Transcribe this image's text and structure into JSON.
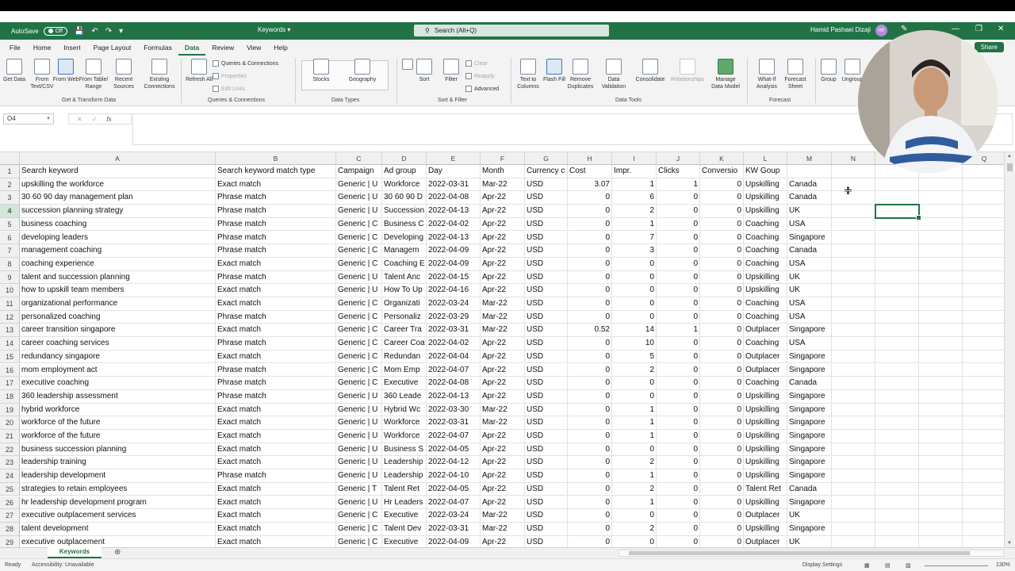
{
  "titlebar": {
    "autosave_label": "AutoSave",
    "autosave_state": "Off",
    "doc_title": "Keywords",
    "search_placeholder": "Search (Alt+Q)",
    "user_name": "Hamid Pashaei Dizaji",
    "user_initials": "HP"
  },
  "menu": {
    "tabs": [
      "File",
      "Home",
      "Insert",
      "Page Layout",
      "Formulas",
      "Data",
      "Review",
      "View",
      "Help"
    ],
    "active": "Data",
    "share_label": "Share"
  },
  "ribbon": {
    "get_data": "Get Data",
    "from_text": "From Text/CSV",
    "from_web": "From Web",
    "from_table": "From Table/ Range",
    "recent_sources": "Recent Sources",
    "existing_connections": "Existing Connections",
    "group_get_transform": "Get & Transform Data",
    "refresh_all": "Refresh All",
    "queries_connections": "Queries & Connections",
    "properties": "Properties",
    "edit_links": "Edit Links",
    "group_queries": "Queries & Connections",
    "stocks": "Stocks",
    "geography": "Geography",
    "group_data_types": "Data Types",
    "sort": "Sort",
    "filter": "Filter",
    "clear": "Clear",
    "reapply": "Reapply",
    "advanced": "Advanced",
    "group_sort_filter": "Sort & Filter",
    "text_to_columns": "Text to Columns",
    "flash_fill": "Flash Fill",
    "remove_duplicates": "Remove Duplicates",
    "data_validation": "Data Validation",
    "consolidate": "Consolidate",
    "relationships": "Relationships",
    "manage_data_model": "Manage Data Model",
    "group_data_tools": "Data Tools",
    "what_if": "What-If Analysis",
    "forecast_sheet": "Forecast Sheet",
    "group_forecast": "Forecast",
    "group": "Group",
    "ungroup": "Ungroup"
  },
  "formula_bar": {
    "name_box": "O4",
    "formula": ""
  },
  "columns": [
    "A",
    "B",
    "C",
    "D",
    "E",
    "F",
    "G",
    "H",
    "I",
    "J",
    "K",
    "L",
    "M",
    "N",
    "O",
    "P",
    "Q"
  ],
  "row_numbers": [
    "1",
    "2",
    "3",
    "4",
    "5",
    "6",
    "7",
    "8",
    "9",
    "10",
    "11",
    "12",
    "13",
    "14",
    "15",
    "16",
    "17",
    "18",
    "19",
    "20",
    "21",
    "22",
    "23",
    "24",
    "25",
    "26",
    "27",
    "28",
    "29"
  ],
  "rows": [
    [
      "Search keyword",
      "Search keyword match type",
      "Campaign",
      "Ad group",
      "Day",
      "Month",
      "Currency c",
      "Cost",
      "Impr.",
      "Clicks",
      "Conversio",
      "KW Goup",
      ""
    ],
    [
      "upskilling the workforce",
      "Exact match",
      "Generic | U",
      "Workforce",
      "2022-03-31",
      "Mar-22",
      "USD",
      "3.07",
      "1",
      "1",
      "0",
      "Upskilling",
      "Canada"
    ],
    [
      "30 60 90 day management plan",
      "Phrase match",
      "Generic | U",
      "30 60 90 D",
      "2022-04-08",
      "Apr-22",
      "USD",
      "0",
      "6",
      "0",
      "0",
      "Upskilling",
      "Canada"
    ],
    [
      "succession planning strategy",
      "Phrase match",
      "Generic | U",
      "Succession",
      "2022-04-13",
      "Apr-22",
      "USD",
      "0",
      "2",
      "0",
      "0",
      "Upskilling",
      "UK"
    ],
    [
      "business coaching",
      "Phrase match",
      "Generic | C",
      "Business C",
      "2022-04-02",
      "Apr-22",
      "USD",
      "0",
      "1",
      "0",
      "0",
      "Coaching",
      "USA"
    ],
    [
      "developing leaders",
      "Phrase match",
      "Generic | C",
      "Developing",
      "2022-04-13",
      "Apr-22",
      "USD",
      "0",
      "7",
      "0",
      "0",
      "Coaching",
      "Singapore"
    ],
    [
      "management coaching",
      "Phrase match",
      "Generic | C",
      "Managem",
      "2022-04-09",
      "Apr-22",
      "USD",
      "0",
      "3",
      "0",
      "0",
      "Coaching",
      "Canada"
    ],
    [
      "coaching experience",
      "Exact match",
      "Generic | C",
      "Coaching E",
      "2022-04-09",
      "Apr-22",
      "USD",
      "0",
      "0",
      "0",
      "0",
      "Coaching",
      "USA"
    ],
    [
      "talent and succession planning",
      "Phrase match",
      "Generic | U",
      "Talent Anc",
      "2022-04-15",
      "Apr-22",
      "USD",
      "0",
      "0",
      "0",
      "0",
      "Upskilling",
      "UK"
    ],
    [
      "how to upskill team members",
      "Exact match",
      "Generic | U",
      "How To Up",
      "2022-04-16",
      "Apr-22",
      "USD",
      "0",
      "0",
      "0",
      "0",
      "Upskilling",
      "UK"
    ],
    [
      "organizational performance",
      "Exact match",
      "Generic | C",
      "Organizati",
      "2022-03-24",
      "Mar-22",
      "USD",
      "0",
      "0",
      "0",
      "0",
      "Coaching",
      "USA"
    ],
    [
      "personalized coaching",
      "Phrase match",
      "Generic | C",
      "Personaliz",
      "2022-03-29",
      "Mar-22",
      "USD",
      "0",
      "0",
      "0",
      "0",
      "Coaching",
      "USA"
    ],
    [
      "career transition singapore",
      "Exact match",
      "Generic | C",
      "Career Tra",
      "2022-03-31",
      "Mar-22",
      "USD",
      "0.52",
      "14",
      "1",
      "0",
      "Outplacer",
      "Singapore"
    ],
    [
      "career coaching services",
      "Phrase match",
      "Generic | C",
      "Career Coa",
      "2022-04-02",
      "Apr-22",
      "USD",
      "0",
      "10",
      "0",
      "0",
      "Coaching",
      "USA"
    ],
    [
      "redundancy singapore",
      "Exact match",
      "Generic | C",
      "Redundan",
      "2022-04-04",
      "Apr-22",
      "USD",
      "0",
      "5",
      "0",
      "0",
      "Outplacer",
      "Singapore"
    ],
    [
      "mom employment act",
      "Phrase match",
      "Generic | C",
      "Mom Emp",
      "2022-04-07",
      "Apr-22",
      "USD",
      "0",
      "2",
      "0",
      "0",
      "Outplacer",
      "Singapore"
    ],
    [
      "executive coaching",
      "Phrase match",
      "Generic | C",
      "Executive",
      "2022-04-08",
      "Apr-22",
      "USD",
      "0",
      "0",
      "0",
      "0",
      "Coaching",
      "Canada"
    ],
    [
      "360 leadership assessment",
      "Phrase match",
      "Generic | U",
      "360 Leade",
      "2022-04-13",
      "Apr-22",
      "USD",
      "0",
      "0",
      "0",
      "0",
      "Upskilling",
      "Singapore"
    ],
    [
      "hybrid workforce",
      "Exact match",
      "Generic | U",
      "Hybrid Wc",
      "2022-03-30",
      "Mar-22",
      "USD",
      "0",
      "1",
      "0",
      "0",
      "Upskilling",
      "Singapore"
    ],
    [
      "workforce of the future",
      "Exact match",
      "Generic | U",
      "Workforce",
      "2022-03-31",
      "Mar-22",
      "USD",
      "0",
      "1",
      "0",
      "0",
      "Upskilling",
      "Singapore"
    ],
    [
      "workforce of the future",
      "Exact match",
      "Generic | U",
      "Workforce",
      "2022-04-07",
      "Apr-22",
      "USD",
      "0",
      "1",
      "0",
      "0",
      "Upskilling",
      "Singapore"
    ],
    [
      "business succession planning",
      "Exact match",
      "Generic | U",
      "Business S",
      "2022-04-05",
      "Apr-22",
      "USD",
      "0",
      "0",
      "0",
      "0",
      "Upskilling",
      "Singapore"
    ],
    [
      "leadership training",
      "Exact match",
      "Generic | U",
      "Leadership",
      "2022-04-12",
      "Apr-22",
      "USD",
      "0",
      "2",
      "0",
      "0",
      "Upskilling",
      "Singapore"
    ],
    [
      "leadership development",
      "Phrase match",
      "Generic | U",
      "Leadership",
      "2022-04-10",
      "Apr-22",
      "USD",
      "0",
      "1",
      "0",
      "0",
      "Upskilling",
      "Singapore"
    ],
    [
      "strategies to retain employees",
      "Exact match",
      "Generic | T",
      "Talent Ret",
      "2022-04-05",
      "Apr-22",
      "USD",
      "0",
      "2",
      "0",
      "0",
      "Talent Ret",
      "Canada"
    ],
    [
      "hr leadership development program",
      "Exact match",
      "Generic | U",
      "Hr Leaders",
      "2022-04-07",
      "Apr-22",
      "USD",
      "0",
      "1",
      "0",
      "0",
      "Upskilling",
      "Singapore"
    ],
    [
      "executive outplacement services",
      "Exact match",
      "Generic | C",
      "Executive",
      "2022-03-24",
      "Mar-22",
      "USD",
      "0",
      "0",
      "0",
      "0",
      "Outplacer",
      "UK"
    ],
    [
      "talent development",
      "Exact match",
      "Generic | C",
      "Talent Dev",
      "2022-03-31",
      "Mar-22",
      "USD",
      "0",
      "2",
      "0",
      "0",
      "Upskilling",
      "Singapore"
    ],
    [
      "executive outplacement",
      "Exact match",
      "Generic | C",
      "Executive",
      "2022-04-09",
      "Apr-22",
      "USD",
      "0",
      "0",
      "0",
      "0",
      "Outplacer",
      "UK"
    ]
  ],
  "sheet_tabs": [
    "Keywords"
  ],
  "statusbar": {
    "ready": "Ready",
    "accessibility": "Accessibility: Unavailable",
    "display_settings": "Display Settings",
    "zoom": "130%"
  },
  "colors": {
    "accent": "#217346",
    "selection": "#217346"
  }
}
